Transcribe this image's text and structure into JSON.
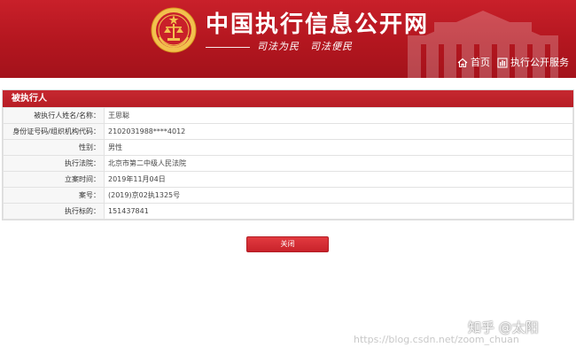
{
  "header": {
    "site_title": "中国执行信息公开网",
    "slogan": "司法为民　司法便民",
    "nav": [
      {
        "label": "首页",
        "icon": "home-icon"
      },
      {
        "label": "执行公开服务",
        "icon": "service-icon"
      }
    ],
    "brand_color": "#b3161f"
  },
  "panel": {
    "title": "被执行人",
    "rows": [
      {
        "label": "被执行人姓名/名称：",
        "value": "王思聪"
      },
      {
        "label": "身份证号码/组织机构代码：",
        "value": "2102031988****4012"
      },
      {
        "label": "性别：",
        "value": "男性"
      },
      {
        "label": "执行法院：",
        "value": "北京市第二中级人民法院"
      },
      {
        "label": "立案时间：",
        "value": "2019年11月04日"
      },
      {
        "label": "案号：",
        "value": "(2019)京02执1325号"
      },
      {
        "label": "执行标的：",
        "value": "151437841"
      }
    ]
  },
  "actions": {
    "close_label": "关闭"
  },
  "watermark": {
    "zhihu": "知乎 @太阳",
    "url": "https://blog.csdn.net/zoom_chuan"
  }
}
